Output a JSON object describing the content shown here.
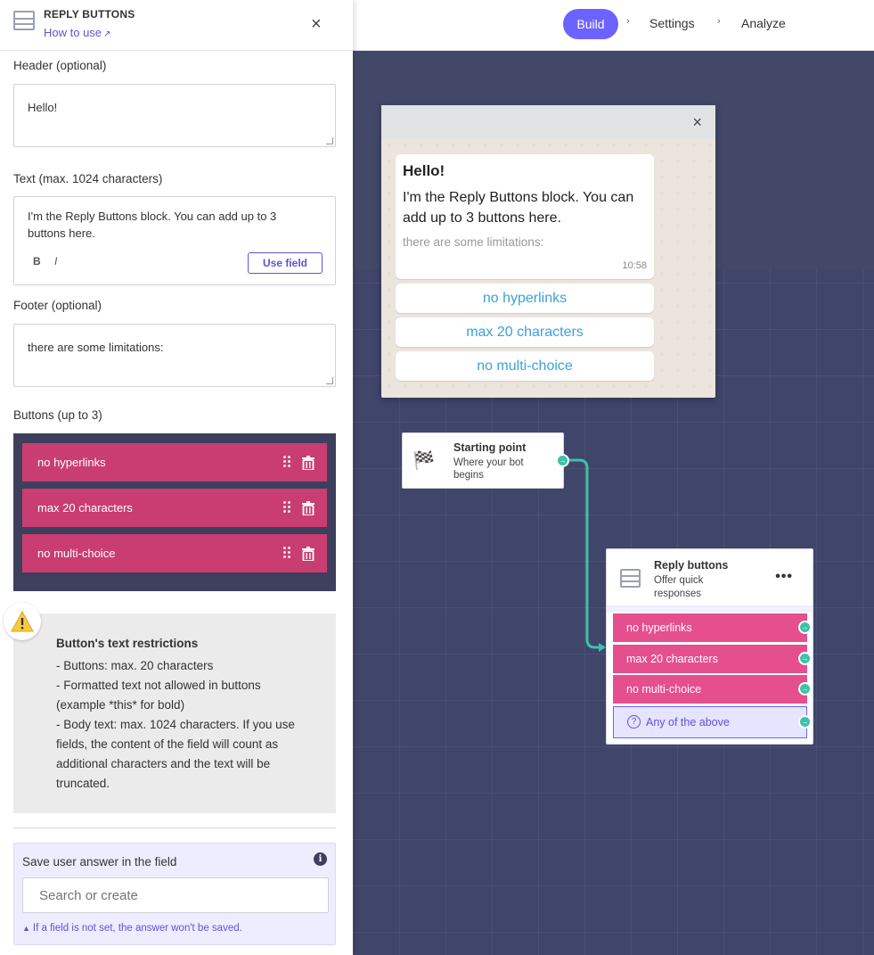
{
  "topnav": {
    "build": "Build",
    "settings": "Settings",
    "analyze": "Analyze",
    "sep": "›"
  },
  "sidebar": {
    "title": "REPLY BUTTONS",
    "how_to_use": "How to use",
    "close": "×",
    "header_label": "Header (optional)",
    "header_value": "Hello!",
    "text_label": "Text (max. 1024 characters)",
    "text_value": "I'm the Reply Buttons block. You can add up to 3 buttons here.",
    "bold_label": "B",
    "italic_label": "I",
    "use_field": "Use field",
    "footer_label": "Footer (optional)",
    "footer_value": "there are some limitations:",
    "buttons_label": "Buttons (up to 3)",
    "buttons": [
      {
        "label": "no hyperlinks"
      },
      {
        "label": "max 20 characters"
      },
      {
        "label": "no multi-choice"
      }
    ],
    "warning": {
      "title": "Button's text restrictions",
      "lines": [
        "- Buttons: max. 20 characters",
        "- Formatted text not allowed in buttons (example *this* for bold)",
        "- Body text: max. 1024 characters. If you use fields, the content of the field will count as additional characters and the text will be truncated."
      ]
    },
    "save": {
      "label": "Save user answer in the field",
      "placeholder": "Search or create",
      "hint": "If a field is not set, the answer won't be saved."
    }
  },
  "preview": {
    "close": "×",
    "header": "Hello!",
    "body": "I'm the Reply Buttons block. You can add up to 3 buttons here.",
    "footer": "there are some limitations:",
    "time": "10:58",
    "buttons": [
      "no hyperlinks",
      "max 20 characters",
      "no multi-choice"
    ]
  },
  "flow": {
    "start": {
      "title": "Starting point",
      "subtitle": "Where your bot begins"
    },
    "reply": {
      "title": "Reply buttons",
      "subtitle": "Offer quick responses",
      "menu": "•••",
      "buttons": [
        "no hyperlinks",
        "max 20 characters",
        "no multi-choice"
      ],
      "any": "Any of the above"
    }
  },
  "colors": {
    "accent": "#6c63ff",
    "button_pink": "#c93d72",
    "node_pink": "#e64f8d",
    "connector": "#3ec1aa",
    "canvas": "#40456a"
  }
}
